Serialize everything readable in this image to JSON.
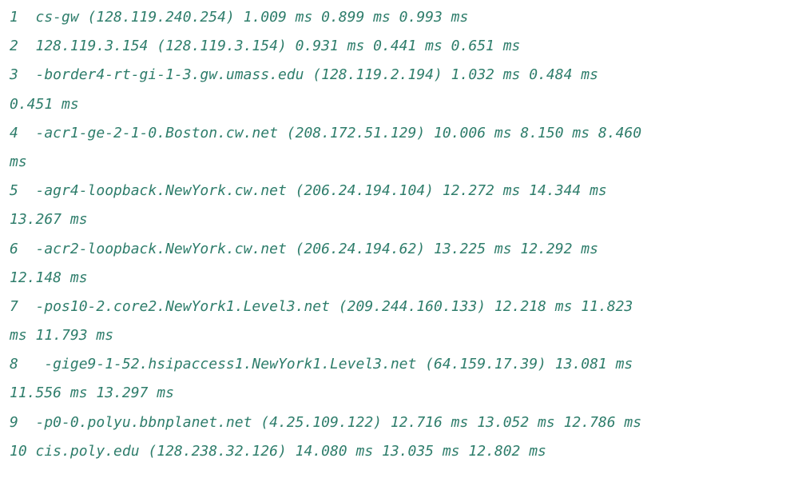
{
  "traceroute": {
    "lines": [
      "1  cs-gw (128.119.240.254) 1.009 ms 0.899 ms 0.993 ms",
      "2  128.119.3.154 (128.119.3.154) 0.931 ms 0.441 ms 0.651 ms",
      "3  -border4-rt-gi-1-3.gw.umass.edu (128.119.2.194) 1.032 ms 0.484 ms",
      "0.451 ms",
      "4  -acr1-ge-2-1-0.Boston.cw.net (208.172.51.129) 10.006 ms 8.150 ms 8.460",
      "ms",
      "5  -agr4-loopback.NewYork.cw.net (206.24.194.104) 12.272 ms 14.344 ms",
      "13.267 ms",
      "6  -acr2-loopback.NewYork.cw.net (206.24.194.62) 13.225 ms 12.292 ms",
      "12.148 ms",
      "7  -pos10-2.core2.NewYork1.Level3.net (209.244.160.133) 12.218 ms 11.823",
      "ms 11.793 ms",
      "8   -gige9-1-52.hsipaccess1.NewYork1.Level3.net (64.159.17.39) 13.081 ms",
      "11.556 ms 13.297 ms",
      "9  -p0-0.polyu.bbnplanet.net (4.25.109.122) 12.716 ms 13.052 ms 12.786 ms",
      "10 cis.poly.edu (128.238.32.126) 14.080 ms 13.035 ms 12.802 ms"
    ]
  },
  "colors": {
    "text": "#2e7d6b",
    "background": "#ffffff"
  }
}
